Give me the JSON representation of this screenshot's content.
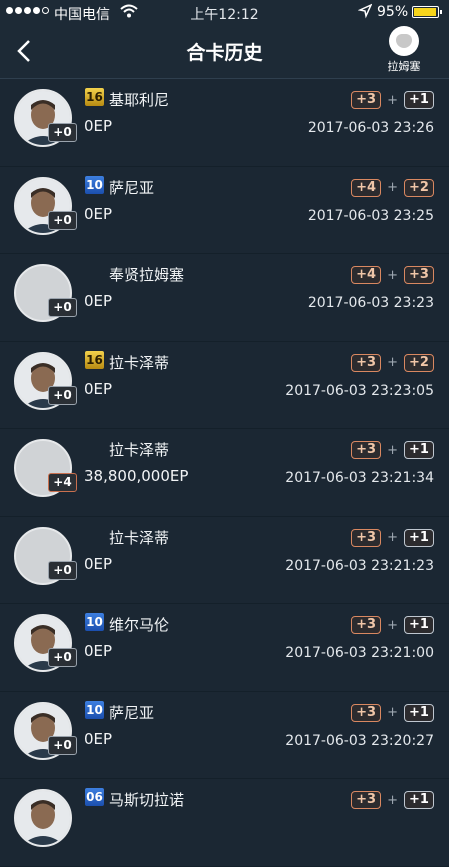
{
  "status_bar": {
    "carrier": "中国电信",
    "time": "上午12:12",
    "battery_percent": "95%",
    "battery_level": 0.95,
    "signal_bars": 4
  },
  "nav": {
    "title": "合卡历史",
    "club_name": "拉姆塞"
  },
  "records": [
    {
      "rating": "16",
      "rating_color": "gold",
      "name": "基耶利尼",
      "ep": "0EP",
      "level": "+0",
      "plus_a": "+3",
      "plus_b": "+1",
      "time": "2017-06-03 23:26",
      "avatar": "photo"
    },
    {
      "rating": "10",
      "rating_color": "blue",
      "name": "萨尼亚",
      "ep": "0EP",
      "level": "+0",
      "plus_a": "+4",
      "plus_b": "+2",
      "time": "2017-06-03 23:25",
      "avatar": "photo"
    },
    {
      "rating": "",
      "rating_color": "",
      "name": "奉贤拉姆塞",
      "ep": "0EP",
      "level": "+0",
      "plus_a": "+4",
      "plus_b": "+3",
      "time": "2017-06-03 23:23",
      "avatar": "blank"
    },
    {
      "rating": "16",
      "rating_color": "gold",
      "name": "拉卡泽蒂",
      "ep": "0EP",
      "level": "+0",
      "plus_a": "+3",
      "plus_b": "+2",
      "time": "2017-06-03 23:23:05",
      "avatar": "photo"
    },
    {
      "rating": "",
      "rating_color": "",
      "name": "拉卡泽蒂",
      "ep": "38,800,000EP",
      "level": "+4",
      "plus_a": "+3",
      "plus_b": "+1",
      "time": "2017-06-03 23:21:34",
      "avatar": "blank"
    },
    {
      "rating": "",
      "rating_color": "",
      "name": "拉卡泽蒂",
      "ep": "0EP",
      "level": "+0",
      "plus_a": "+3",
      "plus_b": "+1",
      "time": "2017-06-03 23:21:23",
      "avatar": "blank"
    },
    {
      "rating": "10",
      "rating_color": "blue",
      "name": "维尔马伦",
      "ep": "0EP",
      "level": "+0",
      "plus_a": "+3",
      "plus_b": "+1",
      "time": "2017-06-03 23:21:00",
      "avatar": "photo"
    },
    {
      "rating": "10",
      "rating_color": "blue",
      "name": "萨尼亚",
      "ep": "0EP",
      "level": "+0",
      "plus_a": "+3",
      "plus_b": "+1",
      "time": "2017-06-03 23:20:27",
      "avatar": "photo"
    },
    {
      "rating": "06",
      "rating_color": "blue",
      "name": "马斯切拉诺",
      "ep": "",
      "level": "",
      "plus_a": "+3",
      "plus_b": "+1",
      "time": "",
      "avatar": "photo"
    }
  ]
}
